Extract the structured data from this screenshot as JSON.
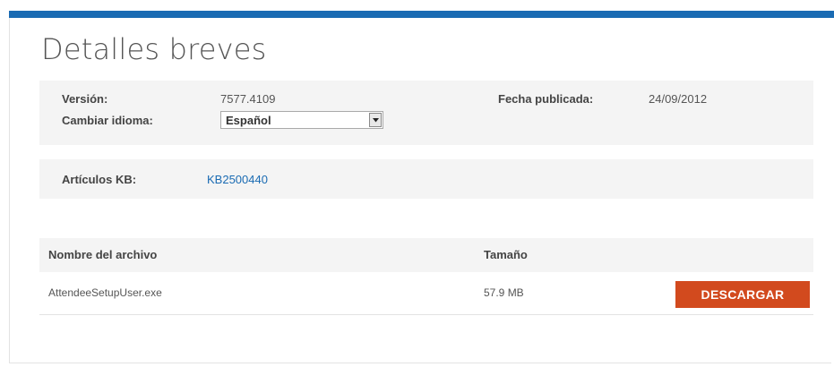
{
  "page": {
    "title": "Detalles breves"
  },
  "details": {
    "version_label": "Versión:",
    "version_value": "7577.4109",
    "language_label": "Cambiar idioma:",
    "language_selected": "Español",
    "published_label": "Fecha publicada:",
    "published_value": "24/09/2012"
  },
  "kb": {
    "label": "Artículos KB:",
    "link_text": "KB2500440"
  },
  "files_table": {
    "columns": [
      "Nombre del archivo",
      "Tamaño"
    ],
    "rows": [
      {
        "file_name": "AttendeeSetupUser.exe",
        "size": "57.9 MB",
        "action_label": "DESCARGAR"
      }
    ]
  },
  "colors": {
    "top_bar": "#1a6bb3",
    "link": "#1a6bb3",
    "download_button": "#d24a1e",
    "panel_background": "#f4f4f4"
  },
  "icons": {
    "select_arrow": "chevron-down-icon"
  }
}
